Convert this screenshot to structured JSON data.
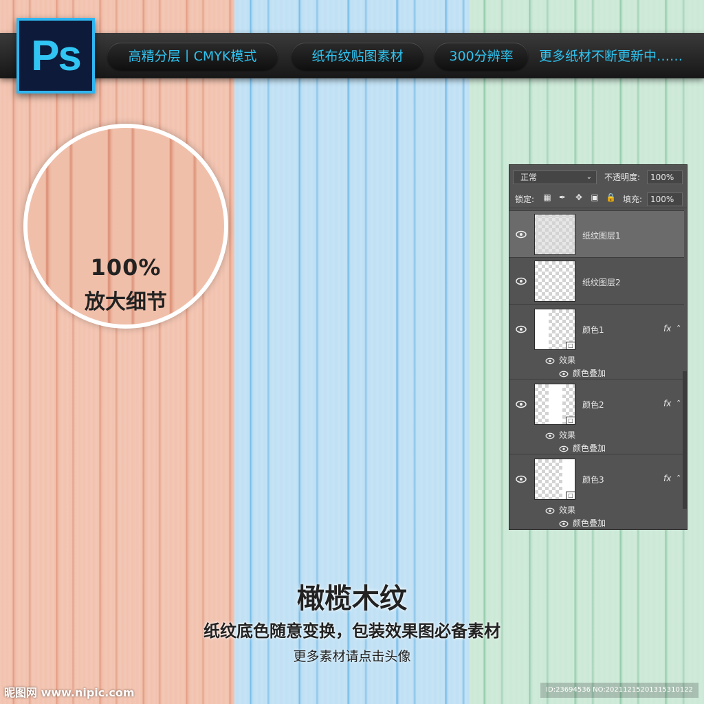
{
  "header": {
    "app_logo": "Ps",
    "pills": [
      "高精分层丨CMYK模式",
      "纸布纹贴图素材",
      "300分辨率"
    ],
    "more_text": "更多纸材不断更新中……"
  },
  "zoom_callout": {
    "percent": "100%",
    "label": "放大细节"
  },
  "layers_panel": {
    "blend_mode": "正常",
    "opacity_label": "不透明度:",
    "opacity_value": "100%",
    "lock_label": "锁定:",
    "fill_label": "填充:",
    "fill_value": "100%",
    "layers": [
      {
        "name": "纸纹图层1",
        "selected": true,
        "type": "paper"
      },
      {
        "name": "纸纹图层2",
        "selected": false,
        "type": "paper"
      },
      {
        "name": "颜色1",
        "fx": "fx",
        "effects_label": "效果",
        "effect": "颜色叠加"
      },
      {
        "name": "颜色2",
        "fx": "fx",
        "effects_label": "效果",
        "effect": "颜色叠加"
      },
      {
        "name": "颜色3",
        "fx": "fx",
        "effects_label": "效果",
        "effect": "颜色叠加"
      }
    ]
  },
  "footer": {
    "title": "橄榄木纹",
    "subtitle": "纸纹底色随意变换，包装效果图必备素材",
    "cta": "更多素材请点击头像",
    "watermark": "昵图网 www.nipic.com",
    "id_strip": "ID:23694536 NO:20211215201315310122"
  },
  "colors": {
    "orange_panel": "#f2c2ae",
    "blue_panel": "#bfe0f4",
    "green_panel": "#cbe8d6",
    "accent": "#2ec3f0"
  }
}
